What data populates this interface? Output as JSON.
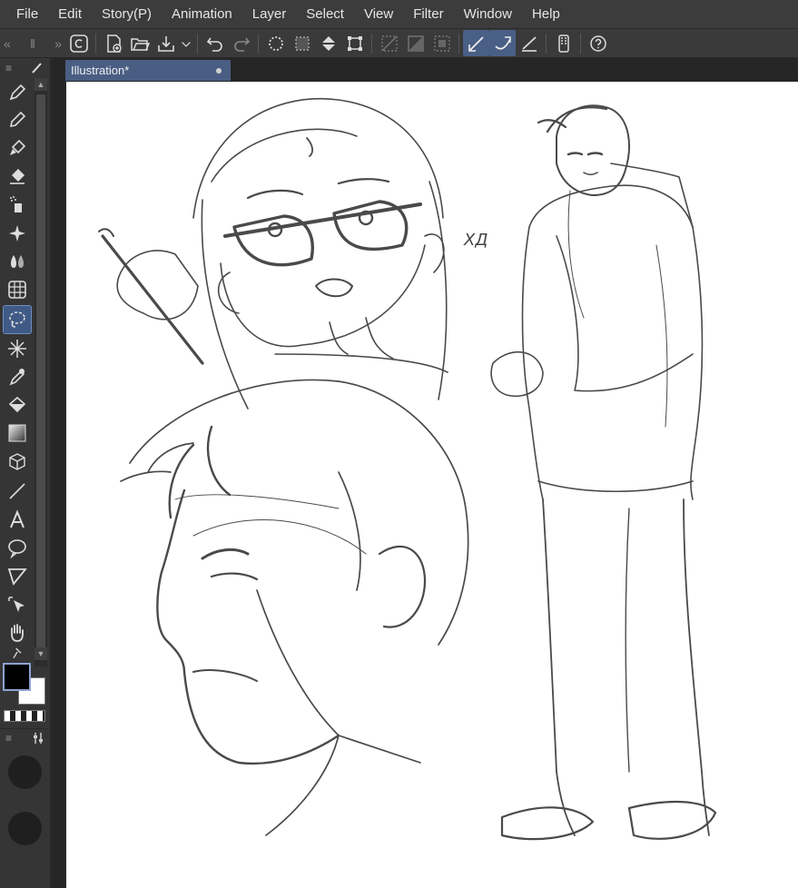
{
  "menu": [
    "File",
    "Edit",
    "Story(P)",
    "Animation",
    "Layer",
    "Select",
    "View",
    "Filter",
    "Window",
    "Help"
  ],
  "command_bar": {
    "icons": [
      "clip-studio-icon",
      "new-file-icon",
      "open-folder-icon",
      "save-icon",
      "dropdown-arrow-icon",
      "undo-icon",
      "redo-icon",
      "clear-selection-icon",
      "select-all-icon",
      "fill-icon",
      "transform-icon",
      "snap-ruler-icon",
      "snap-grid-icon",
      "snap-special-icon",
      "stabilize-icon",
      "vector-magnet-icon",
      "draw-icon",
      "tablet-icon",
      "help-icon"
    ]
  },
  "toolbar": {
    "tools": [
      "pen-icon",
      "pencil-icon",
      "brush-icon",
      "eraser-icon",
      "airbrush-icon",
      "decoration-icon",
      "blend-icon",
      "mesh-icon",
      "lasso-selection-icon",
      "auto-select-icon",
      "eyedropper-icon",
      "fill-bucket-icon",
      "gradient-icon",
      "3d-object-icon",
      "line-icon",
      "text-icon",
      "balloon-icon",
      "frame-border-icon",
      "object-select-icon",
      "hand-icon",
      "pin-icon"
    ],
    "active_tool": "lasso-selection-icon"
  },
  "colors": {
    "main": "#000000",
    "sub": "#ffffff",
    "accent": "#4a5e84"
  },
  "document": {
    "tab_title": "Illustration*"
  },
  "sketch": {
    "note": "ХД"
  }
}
